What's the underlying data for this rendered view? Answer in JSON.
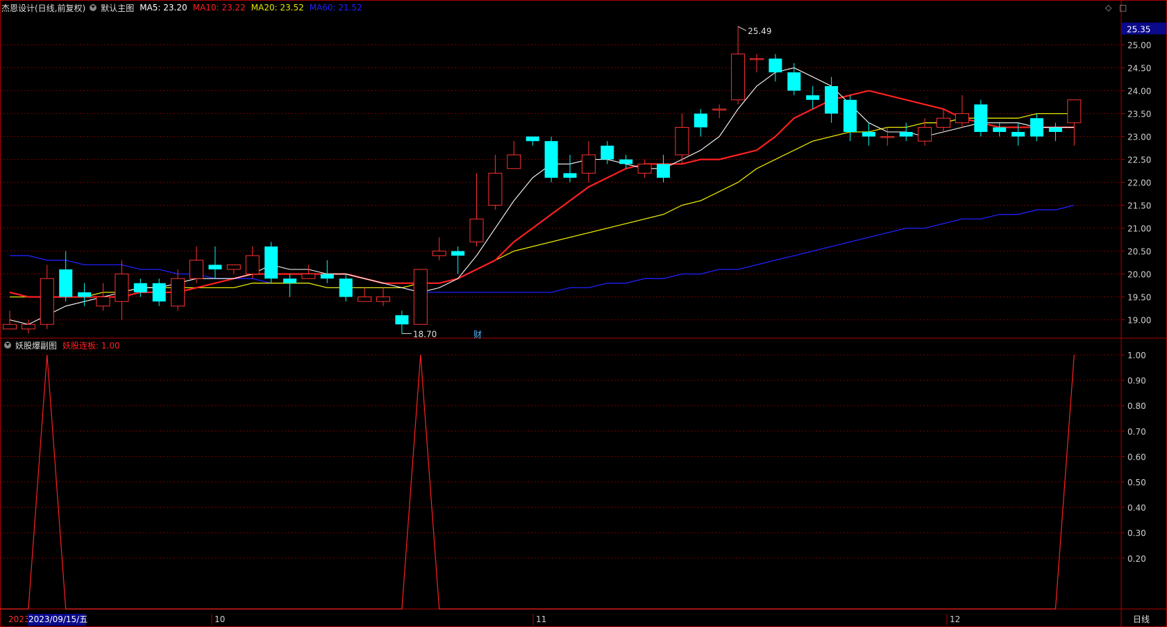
{
  "main_header": {
    "stock": "杰恩设计(日线,前复权)",
    "indicator": "默认主图",
    "ma5": "MA5: 23.20",
    "ma10": "MA10: 23.22",
    "ma20": "MA20: 23.52",
    "ma60": "MA60: 21.52"
  },
  "sub_header": {
    "indicator": "妖股爆副图",
    "value": "妖股连板: 1.00"
  },
  "icons": {
    "diamond": "◇",
    "square": "□"
  },
  "current_price": "25.35",
  "max_label": "25.49",
  "min_label": "18.70",
  "cai_label": "财",
  "period_label": "日线",
  "colors": {
    "up": "#ff3232",
    "down": "#00ffff",
    "ma5": "#ffffff",
    "ma10": "#ff2020",
    "ma20": "#e8e800",
    "ma60": "#2020ff",
    "grid": "#7a0000",
    "axis": "#b00000",
    "sub_line": "#ff2020"
  },
  "chart_data": [
    {
      "type": "candlestick",
      "ylim": [
        18.6,
        25.6
      ],
      "yticks": [
        "25.00",
        "24.50",
        "24.00",
        "23.50",
        "23.00",
        "22.50",
        "22.00",
        "21.50",
        "21.00",
        "20.50",
        "20.00",
        "19.50",
        "19.00"
      ],
      "candles": [
        [
          18.8,
          18.9,
          19.2,
          18.8
        ],
        [
          18.8,
          18.9,
          19.0,
          18.7
        ],
        [
          18.9,
          19.9,
          20.2,
          18.8
        ],
        [
          20.1,
          19.5,
          20.5,
          19.4
        ],
        [
          19.6,
          19.5,
          19.8,
          19.3
        ],
        [
          19.3,
          19.5,
          19.8,
          19.2
        ],
        [
          19.4,
          20.0,
          20.3,
          19.0
        ],
        [
          19.8,
          19.6,
          19.9,
          19.5
        ],
        [
          19.8,
          19.4,
          19.9,
          19.3
        ],
        [
          19.3,
          19.9,
          20.1,
          19.2
        ],
        [
          19.9,
          20.3,
          20.6,
          19.8
        ],
        [
          20.2,
          20.1,
          20.6,
          19.9
        ],
        [
          20.1,
          20.2,
          20.2,
          20.0
        ],
        [
          20.0,
          20.4,
          20.6,
          19.9
        ],
        [
          20.6,
          19.9,
          20.7,
          19.8
        ],
        [
          19.9,
          19.8,
          20.0,
          19.5
        ],
        [
          19.9,
          20.0,
          20.2,
          19.9
        ],
        [
          20.0,
          19.9,
          20.3,
          19.8
        ],
        [
          19.9,
          19.5,
          20.0,
          19.4
        ],
        [
          19.4,
          19.5,
          19.7,
          19.4
        ],
        [
          19.4,
          19.5,
          19.7,
          19.3
        ],
        [
          19.1,
          18.9,
          19.2,
          18.7
        ],
        [
          18.9,
          20.1,
          20.1,
          18.9
        ],
        [
          20.4,
          20.5,
          20.8,
          20.3
        ],
        [
          20.5,
          20.4,
          20.6,
          20.0
        ],
        [
          20.7,
          21.2,
          22.2,
          20.6
        ],
        [
          21.5,
          22.2,
          22.6,
          21.4
        ],
        [
          22.3,
          22.6,
          22.9,
          22.3
        ],
        [
          23.0,
          22.9,
          23.0,
          22.8
        ],
        [
          22.9,
          22.1,
          23.0,
          22.0
        ],
        [
          22.2,
          22.1,
          22.6,
          22.0
        ],
        [
          22.2,
          22.6,
          22.9,
          22.0
        ],
        [
          22.8,
          22.5,
          22.9,
          22.4
        ],
        [
          22.5,
          22.4,
          22.6,
          22.3
        ],
        [
          22.2,
          22.4,
          22.5,
          22.1
        ],
        [
          22.4,
          22.1,
          22.6,
          22.0
        ],
        [
          22.6,
          23.2,
          23.5,
          22.4
        ],
        [
          23.5,
          23.2,
          23.6,
          23.0
        ],
        [
          23.6,
          23.6,
          23.7,
          23.4
        ],
        [
          23.8,
          24.8,
          25.4,
          23.7
        ],
        [
          24.7,
          24.7,
          24.8,
          24.4
        ],
        [
          24.7,
          24.4,
          24.8,
          24.2
        ],
        [
          24.4,
          24.0,
          24.6,
          23.9
        ],
        [
          23.9,
          23.8,
          24.1,
          23.6
        ],
        [
          24.1,
          23.5,
          24.3,
          23.3
        ],
        [
          23.8,
          23.1,
          23.9,
          22.9
        ],
        [
          23.1,
          23.0,
          23.3,
          22.8
        ],
        [
          23.0,
          23.0,
          23.2,
          22.8
        ],
        [
          23.1,
          23.0,
          23.3,
          22.9
        ],
        [
          22.9,
          23.2,
          23.4,
          22.8
        ],
        [
          23.2,
          23.4,
          23.6,
          23.1
        ],
        [
          23.3,
          23.5,
          23.9,
          23.2
        ],
        [
          23.7,
          23.1,
          23.8,
          23.0
        ],
        [
          23.2,
          23.1,
          23.3,
          23.0
        ],
        [
          23.1,
          23.0,
          23.3,
          22.8
        ],
        [
          23.4,
          23.0,
          23.5,
          22.9
        ],
        [
          23.2,
          23.1,
          23.3,
          22.9
        ],
        [
          23.3,
          23.8,
          23.8,
          22.8
        ]
      ],
      "ma5": [
        19.0,
        18.9,
        19.1,
        19.3,
        19.4,
        19.5,
        19.6,
        19.7,
        19.7,
        19.8,
        19.9,
        19.9,
        19.9,
        20.0,
        20.2,
        20.1,
        20.1,
        20.0,
        20.0,
        19.9,
        19.8,
        19.7,
        19.6,
        19.7,
        19.9,
        20.4,
        21.0,
        21.6,
        22.1,
        22.4,
        22.4,
        22.5,
        22.5,
        22.4,
        22.3,
        22.3,
        22.5,
        22.7,
        23.0,
        23.6,
        24.1,
        24.4,
        24.5,
        24.3,
        24.1,
        23.7,
        23.3,
        23.1,
        23.1,
        23.0,
        23.1,
        23.2,
        23.3,
        23.3,
        23.3,
        23.2,
        23.2,
        23.2
      ],
      "ma10": [
        19.6,
        19.5,
        19.5,
        19.5,
        19.5,
        19.5,
        19.5,
        19.6,
        19.6,
        19.6,
        19.7,
        19.8,
        19.9,
        20.0,
        20.0,
        20.0,
        20.0,
        20.0,
        20.0,
        19.9,
        19.8,
        19.8,
        19.8,
        19.8,
        19.9,
        20.1,
        20.3,
        20.7,
        21.0,
        21.3,
        21.6,
        21.9,
        22.1,
        22.3,
        22.4,
        22.4,
        22.4,
        22.5,
        22.5,
        22.6,
        22.7,
        23.0,
        23.4,
        23.6,
        23.8,
        23.9,
        24.0,
        23.9,
        23.8,
        23.7,
        23.6,
        23.4,
        23.3,
        23.2,
        23.2,
        23.2,
        23.2,
        23.2
      ],
      "ma20": [
        19.5,
        19.5,
        19.5,
        19.5,
        19.5,
        19.6,
        19.6,
        19.7,
        19.7,
        19.7,
        19.7,
        19.7,
        19.7,
        19.8,
        19.8,
        19.8,
        19.8,
        19.7,
        19.7,
        19.7,
        19.7,
        19.7,
        19.8,
        19.8,
        19.9,
        20.1,
        20.3,
        20.5,
        20.6,
        20.7,
        20.8,
        20.9,
        21.0,
        21.1,
        21.2,
        21.3,
        21.5,
        21.6,
        21.8,
        22.0,
        22.3,
        22.5,
        22.7,
        22.9,
        23.0,
        23.1,
        23.1,
        23.2,
        23.2,
        23.3,
        23.3,
        23.4,
        23.4,
        23.4,
        23.4,
        23.5,
        23.5,
        23.5
      ],
      "ma60": [
        20.4,
        20.4,
        20.3,
        20.3,
        20.2,
        20.2,
        20.2,
        20.1,
        20.1,
        20.0,
        20.0,
        19.9,
        19.9,
        19.9,
        19.8,
        19.8,
        19.8,
        19.7,
        19.7,
        19.7,
        19.7,
        19.7,
        19.6,
        19.6,
        19.6,
        19.6,
        19.6,
        19.6,
        19.6,
        19.6,
        19.7,
        19.7,
        19.8,
        19.8,
        19.9,
        19.9,
        20.0,
        20.0,
        20.1,
        20.1,
        20.2,
        20.3,
        20.4,
        20.5,
        20.6,
        20.7,
        20.8,
        20.9,
        21.0,
        21.0,
        21.1,
        21.2,
        21.2,
        21.3,
        21.3,
        21.4,
        21.4,
        21.5
      ]
    },
    {
      "type": "line",
      "name": "妖股连板",
      "ylim": [
        0.0,
        1.0
      ],
      "yticks": [
        "1.00",
        "0.90",
        "0.80",
        "0.70",
        "0.60",
        "0.50",
        "0.40",
        "0.30",
        "0.20"
      ],
      "values": [
        0,
        0,
        1,
        0,
        0,
        0,
        0,
        0,
        0,
        0,
        0,
        0,
        0,
        0,
        0,
        0,
        0,
        0,
        0,
        0,
        0,
        0,
        1,
        0,
        0,
        0,
        0,
        0,
        0,
        0,
        0,
        0,
        0,
        0,
        0,
        0,
        0,
        0,
        0,
        0,
        0,
        0,
        0,
        0,
        0,
        0,
        0,
        0,
        0,
        0,
        0,
        0,
        0,
        0,
        0,
        0,
        0,
        1
      ]
    }
  ],
  "time_axis": [
    "2023",
    "2023/09/15/五",
    "10",
    "11",
    "12"
  ]
}
